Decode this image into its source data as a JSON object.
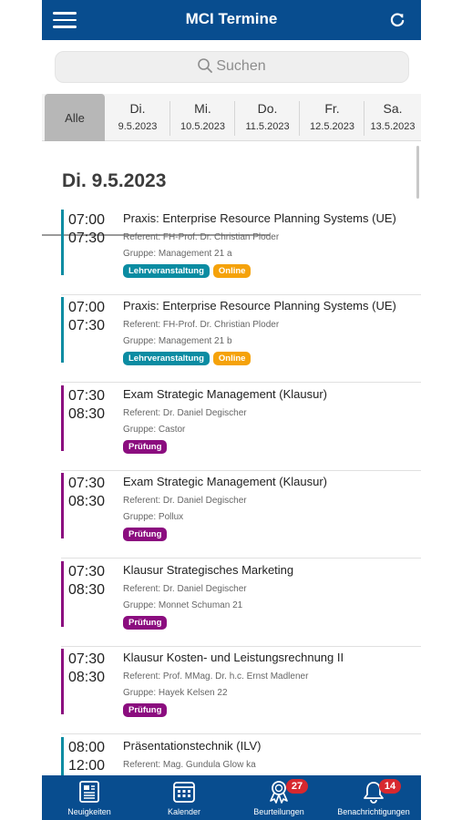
{
  "app": {
    "title": "MCI Termine"
  },
  "search": {
    "placeholder": "Suchen"
  },
  "colors": {
    "brand": "#084d8f",
    "teal": "#0b8ca2",
    "purple": "#8b0d7f",
    "orange": "#f5a20b",
    "badge": "#d7282f"
  },
  "day_tabs": [
    {
      "label": "Alle",
      "selected": true
    },
    {
      "day": "Di.",
      "date": "9.5.2023"
    },
    {
      "day": "Mi.",
      "date": "10.5.2023"
    },
    {
      "day": "Do.",
      "date": "11.5.2023"
    },
    {
      "day": "Fr.",
      "date": "12.5.2023"
    },
    {
      "day": "Sa.",
      "date": "13.5.2023"
    }
  ],
  "day_heading": "Di. 9.5.2023",
  "events": [
    {
      "start": "07:00",
      "end": "07:30",
      "title": "Praxis: Enterprise Resource Planning Systems (UE)",
      "referent": "Referent: FH-Prof. Dr. Christian Ploder",
      "group": "Gruppe: Management 21 a",
      "tags": [
        "Lehrveranstaltung",
        "Online"
      ],
      "category": "teal"
    },
    {
      "start": "07:00",
      "end": "07:30",
      "title": "Praxis: Enterprise Resource Planning Systems (UE)",
      "referent": "Referent: FH-Prof. Dr. Christian Ploder",
      "group": "Gruppe: Management 21 b",
      "tags": [
        "Lehrveranstaltung",
        "Online"
      ],
      "category": "teal"
    },
    {
      "start": "07:30",
      "end": "08:30",
      "title": "Exam Strategic Management (Klausur)",
      "referent": "Referent: Dr. Daniel Degischer",
      "group": "Gruppe: Castor",
      "tags": [
        "Prüfung"
      ],
      "category": "purple"
    },
    {
      "start": "07:30",
      "end": "08:30",
      "title": "Exam Strategic Management (Klausur)",
      "referent": "Referent: Dr. Daniel Degischer",
      "group": "Gruppe: Pollux",
      "tags": [
        "Prüfung"
      ],
      "category": "purple"
    },
    {
      "start": "07:30",
      "end": "08:30",
      "title": "Klausur Strategisches Marketing",
      "referent": "Referent: Dr. Daniel Degischer",
      "group": "Gruppe: Monnet Schuman 21",
      "tags": [
        "Prüfung"
      ],
      "category": "purple"
    },
    {
      "start": "07:30",
      "end": "08:30",
      "title": "Klausur Kosten- und Leistungsrechnung II",
      "referent": "Referent: Prof. MMag. Dr. h.c. Ernst Madlener",
      "group": "Gruppe: Hayek Kelsen 22",
      "tags": [
        "Prüfung"
      ],
      "category": "purple"
    },
    {
      "start": "08:00",
      "end": "12:00",
      "title": "Präsentationstechnik (ILV)",
      "referent": "Referent: Mag. Gundula Glow ka",
      "group": "",
      "tags": [],
      "category": "teal"
    }
  ],
  "bottom_nav": [
    {
      "label": "Neuigkeiten",
      "icon": "newspaper-icon"
    },
    {
      "label": "Kalender",
      "icon": "calendar-icon"
    },
    {
      "label": "Beurteilungen",
      "icon": "award-icon",
      "badge": "27"
    },
    {
      "label": "Benachrichtigungen",
      "icon": "bell-icon",
      "badge": "14"
    }
  ]
}
